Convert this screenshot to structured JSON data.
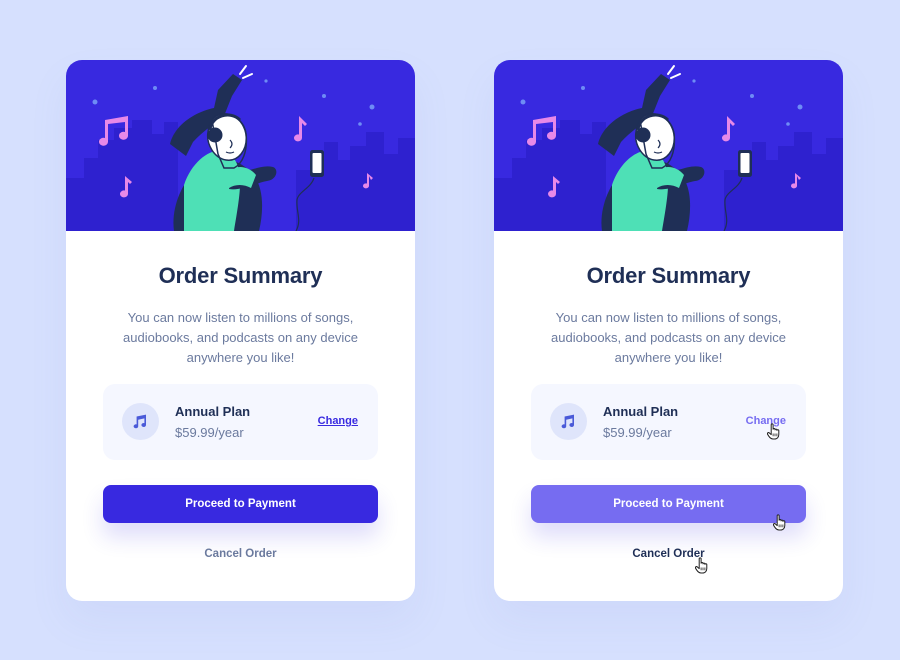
{
  "cards": [
    {
      "variant": "default",
      "title": "Order Summary",
      "description": "You can now listen to millions of songs, audiobooks, and podcasts on any device anywhere you like!",
      "plan": {
        "name": "Annual Plan",
        "price": "$59.99/year",
        "change_label": "Change"
      },
      "proceed_label": "Proceed to Payment",
      "cancel_label": "Cancel Order"
    },
    {
      "variant": "hover",
      "title": "Order Summary",
      "description": "You can now listen to millions of songs, audiobooks, and podcasts on any device anywhere you like!",
      "plan": {
        "name": "Annual Plan",
        "price": "$59.99/year",
        "change_label": "Change"
      },
      "proceed_label": "Proceed to Payment",
      "cancel_label": "Cancel Order"
    }
  ],
  "icons": {
    "hero": "woman-dancing-with-headphones-illustration",
    "plan": "music-note-icon",
    "cursor": "hand-pointer-icon"
  },
  "colors": {
    "background": "#d6e0fe",
    "hero_blue": "#3829e0",
    "primary": "#3829e0",
    "primary_hover": "#766cf1",
    "title": "#1f2f56",
    "body_text": "#6b7a9e",
    "plan_bg": "#f5f7ff"
  }
}
